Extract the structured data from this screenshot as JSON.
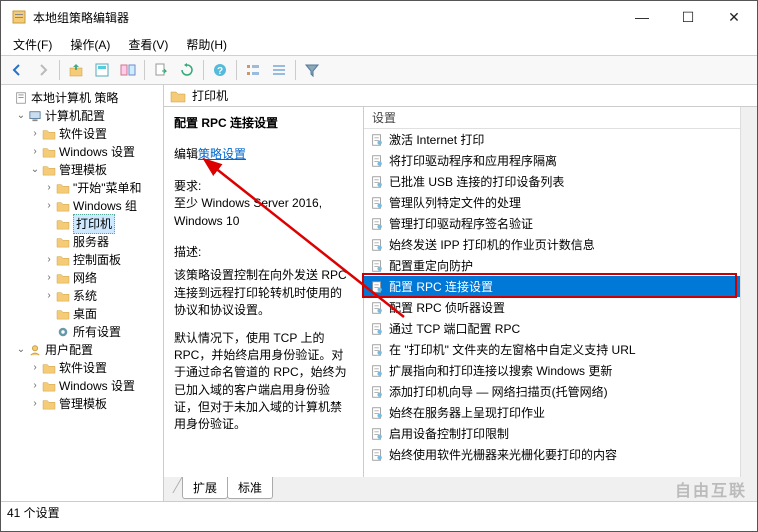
{
  "window": {
    "title": "本地组策略编辑器",
    "minimize": "—",
    "maximize": "☐",
    "close": "✕"
  },
  "menu": {
    "file": "文件(F)",
    "action": "操作(A)",
    "view": "查看(V)",
    "help": "帮助(H)"
  },
  "toolbar_icons": [
    "back-icon",
    "forward-icon",
    "up-icon",
    "sep",
    "props-icon",
    "detail-icon",
    "sep",
    "refresh-icon",
    "help-icon",
    "sep",
    "list1-icon",
    "list2-icon",
    "sep",
    "filter-icon"
  ],
  "tree": {
    "root": "本地计算机 策略",
    "computer": "计算机配置",
    "soft": "软件设置",
    "windows": "Windows 设置",
    "templates": "管理模板",
    "startmenu": "\"开始\"菜单和",
    "wincomp": "Windows 组",
    "printers": "打印机",
    "servers": "服务器",
    "cpanel": "控制面板",
    "network": "网络",
    "system": "系统",
    "desktop": "桌面",
    "allset": "所有设置",
    "user": "用户配置",
    "usoft": "软件设置",
    "uwin": "Windows 设置",
    "utmpl": "管理模板"
  },
  "path": {
    "label": "打印机"
  },
  "detail": {
    "title": "配置 RPC 连接设置",
    "edit_label_prefix": "编辑",
    "edit_link": "策略设置",
    "req_label": "要求:",
    "req_text": "至少 Windows Server 2016, Windows 10",
    "desc_label": "描述:",
    "desc1": "该策略设置控制在向外发送 RPC 连接到远程打印轮转机时使用的协议和协议设置。",
    "desc2": "默认情况下，使用 TCP 上的 RPC，并始终启用身份验证。对于通过命名管道的 RPC，始终为已加入域的客户端启用身份验证，但对于未加入域的计算机禁用身份验证。"
  },
  "list_header": "设置",
  "settings": [
    "激活 Internet 打印",
    "将打印驱动程序和应用程序隔离",
    "已批准 USB 连接的打印设备列表",
    "管理队列特定文件的处理",
    "管理打印驱动程序签名验证",
    "始终发送 IPP 打印机的作业页计数信息",
    "配置重定向防护",
    "配置 RPC 连接设置",
    "配置 RPC 侦听器设置",
    "通过 TCP 端口配置 RPC",
    "在 \"打印机\" 文件夹的左窗格中自定义支持 URL",
    "扩展指向和打印连接以搜索 Windows 更新",
    "添加打印机向导 — 网络扫描页(托管网络)",
    "始终在服务器上呈现打印作业",
    "启用设备控制打印限制",
    "始终使用软件光栅器来光栅化要打印的内容"
  ],
  "selected_index": 7,
  "tabs": {
    "extended": "扩展",
    "standard": "标准"
  },
  "status": "41 个设置",
  "watermark": "自由互联"
}
